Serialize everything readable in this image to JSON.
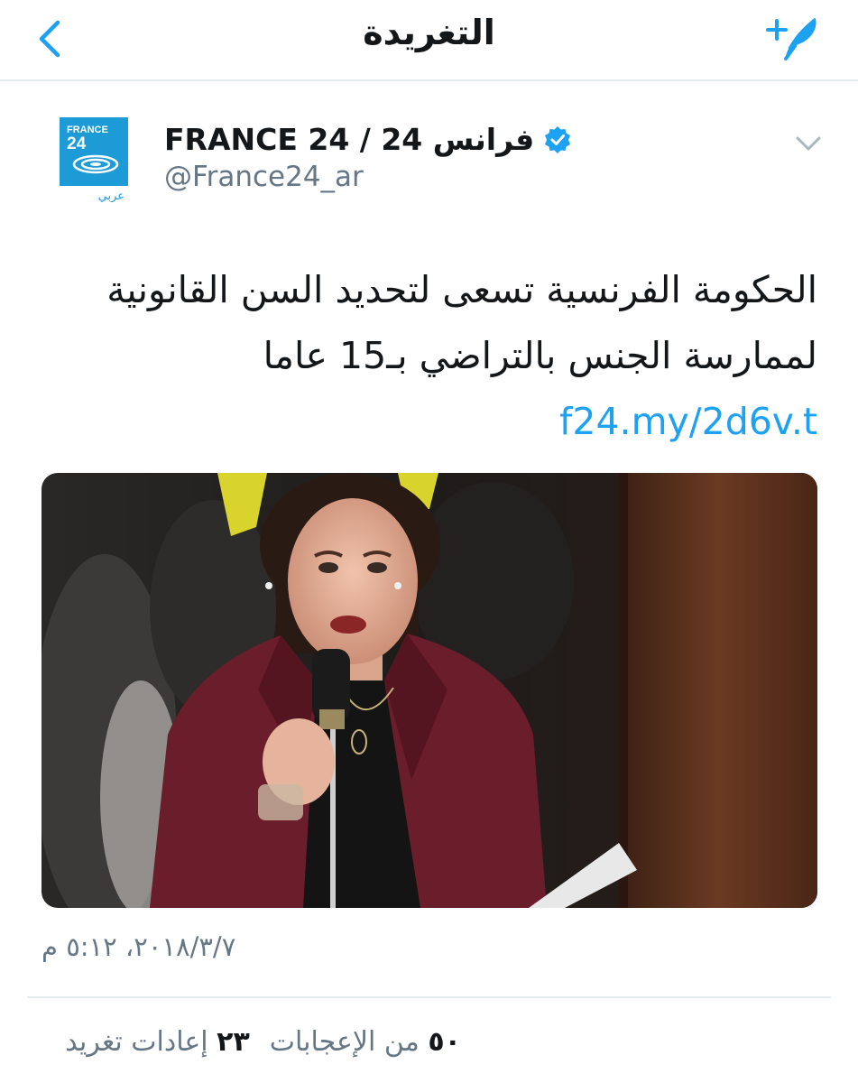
{
  "header": {
    "title": "التغريدة",
    "back_icon": "chevron-left-icon",
    "compose_icon": "feather-plus-icon",
    "accent": "#1da1f2"
  },
  "tweet": {
    "avatar": {
      "brand_text": "FRANCE 24",
      "sub_text": "عربي",
      "brand_color": "#1d9bd7"
    },
    "display_name": "FRANCE 24 / 24 فرانس",
    "verified_icon": "verified-badge-icon",
    "handle": "@France24_ar",
    "caret_icon": "chevron-down-icon",
    "text": "الحكومة الفرنسية تسعى لتحديد السن القانونية لممارسة الجنس بالتراضي بـ15 عاما",
    "link": "f24.my/2d6v.t",
    "timestamp": "٢٠١٨/٣/٧، ٥:١٢ م",
    "stats": {
      "retweets_count": "٢٣",
      "retweets_label": "إعادات تغريد",
      "likes_count": "٥٠",
      "likes_label": "من الإعجابات"
    }
  }
}
